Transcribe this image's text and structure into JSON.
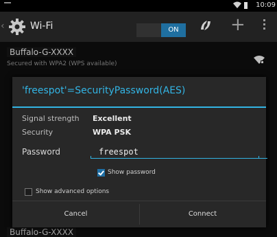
{
  "status_bar": {
    "time": "10:09",
    "wifi_icon": "wifi-signal-icon",
    "battery_icon": "battery-icon",
    "notification_icon": "notification-icon"
  },
  "action_bar": {
    "title": "Wi-Fi",
    "toggle_label": "ON",
    "settings_icon": "gear-icon",
    "wps_icon": "wps-icon",
    "add_icon": "plus-icon",
    "menu_icon": "overflow-menu-icon"
  },
  "networks": [
    {
      "ssid": "Buffalo-G-XXXX",
      "subtitle": "Secured with WPA2 (WPS available)"
    },
    {
      "ssid": "Buffalo-G-XXXX",
      "subtitle": ""
    }
  ],
  "dialog": {
    "title": "'freespot'=SecurityPassword(AES)",
    "rows": [
      {
        "label": "Signal strength",
        "value": "Excellent"
      },
      {
        "label": "Security",
        "value": "WPA PSK"
      }
    ],
    "password_label": "Password",
    "password_value": "freespot",
    "show_password_label": "Show password",
    "show_password_checked": true,
    "advanced_label": "Show advanced options",
    "advanced_checked": false,
    "cancel_label": "Cancel",
    "connect_label": "Connect"
  },
  "colors": {
    "accent": "#33b5e5",
    "toggle_on": "#1f6fa0",
    "dialog_bg": "#282828"
  }
}
